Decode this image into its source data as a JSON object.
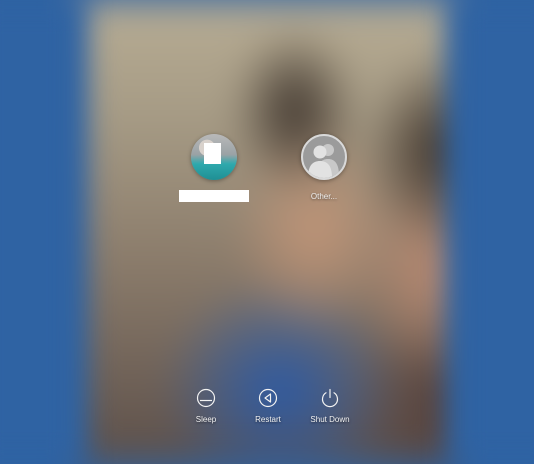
{
  "users": [
    {
      "id": "main",
      "name": "",
      "avatar": "user-photo-icon"
    },
    {
      "id": "other",
      "name": "Other...",
      "avatar": "generic-user-icon"
    }
  ],
  "controls": {
    "sleep": {
      "label": "Sleep",
      "icon": "sleep-icon"
    },
    "restart": {
      "label": "Restart",
      "icon": "restart-icon"
    },
    "shutdown": {
      "label": "Shut Down",
      "icon": "power-icon"
    }
  },
  "colors": {
    "background": "#2f63a3",
    "text": "#f2f2f2"
  }
}
